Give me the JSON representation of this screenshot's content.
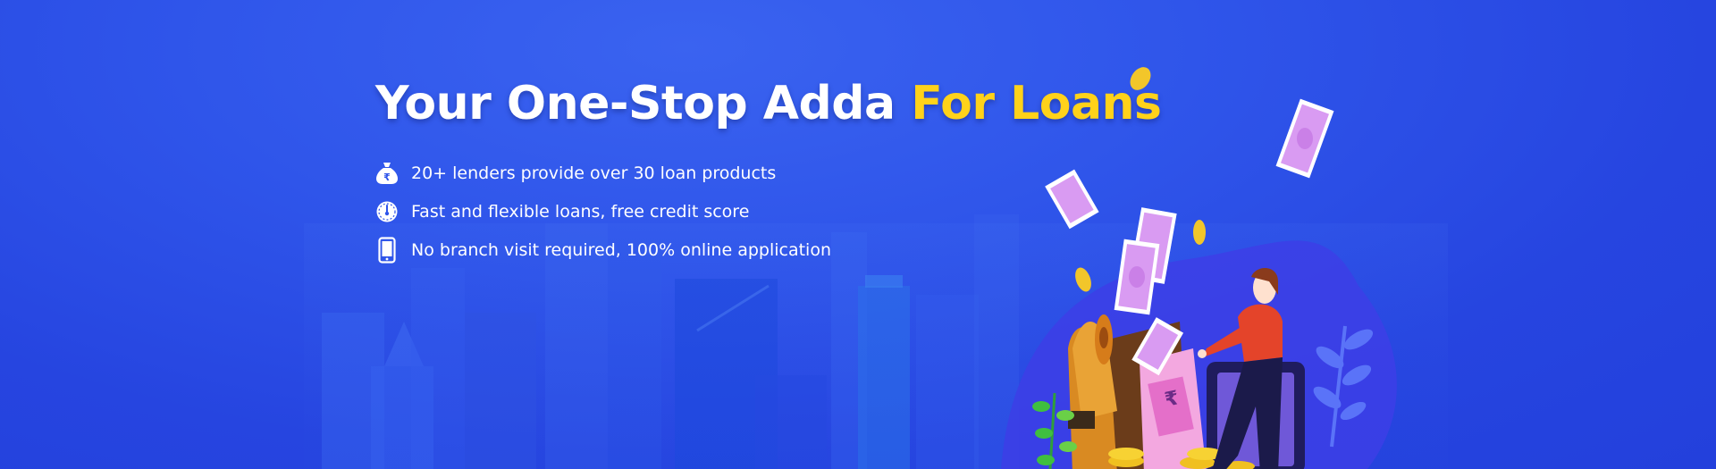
{
  "banner": {
    "headline_main": "Your One-Stop Adda",
    "headline_accent": "For Loans",
    "features": [
      {
        "icon": "money-bag-icon",
        "text": "20+ lenders provide over 30 loan products"
      },
      {
        "icon": "speedometer-icon",
        "text": "Fast and flexible loans, free credit score"
      },
      {
        "icon": "mobile-phone-icon",
        "text": "No branch visit required, 100% online application"
      }
    ]
  },
  "colors": {
    "background": "#2f55ea",
    "headline": "#ffffff",
    "accent": "#ffd21a",
    "text": "#ffffff"
  }
}
